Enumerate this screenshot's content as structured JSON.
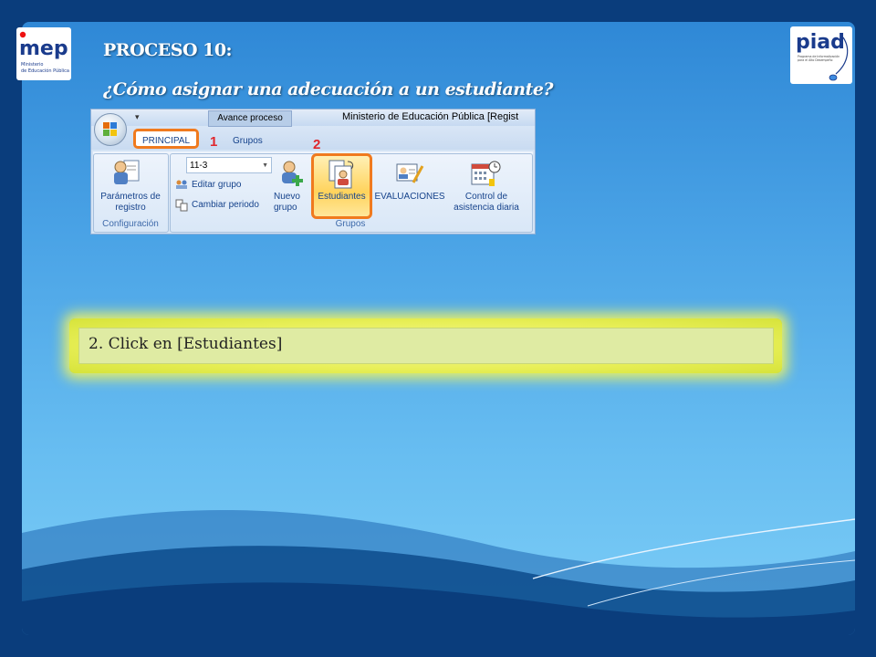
{
  "slide": {
    "title": "PROCESO 10:",
    "subtitle": "¿Cómo  asignar una adecuación  a un estudiante?",
    "instruction": "2. Click en [Estudiantes]"
  },
  "logos": {
    "left": {
      "text": "mep",
      "small_text": "Ministerio de Educación Pública"
    },
    "right": {
      "text": "piad",
      "small_text": "Programa de Informatización para el Alto Desempeño"
    }
  },
  "ribbon": {
    "window_title": "Ministerio de Educación Pública [Regist",
    "context_tab": "Avance proceso",
    "tabs": [
      {
        "label": "PRINCIPAL"
      },
      {
        "label": "Grupos"
      }
    ],
    "markers": [
      "1",
      "2"
    ],
    "combo_value": "11-3",
    "small_buttons": [
      "Editar grupo",
      "Cambiar periodo"
    ],
    "buttons": {
      "parametros": "Parámetros de registro",
      "nuevo_grupo": "Nuevo grupo",
      "estudiantes": "Estudiantes",
      "evaluaciones": "EVALUACIONES",
      "control": "Control de asistencia diaria"
    },
    "groups": [
      "Configuración",
      "Grupos"
    ]
  },
  "colors": {
    "highlight": "#f07a1e",
    "marker": "#e0262c",
    "background": "#0a3d7c"
  }
}
